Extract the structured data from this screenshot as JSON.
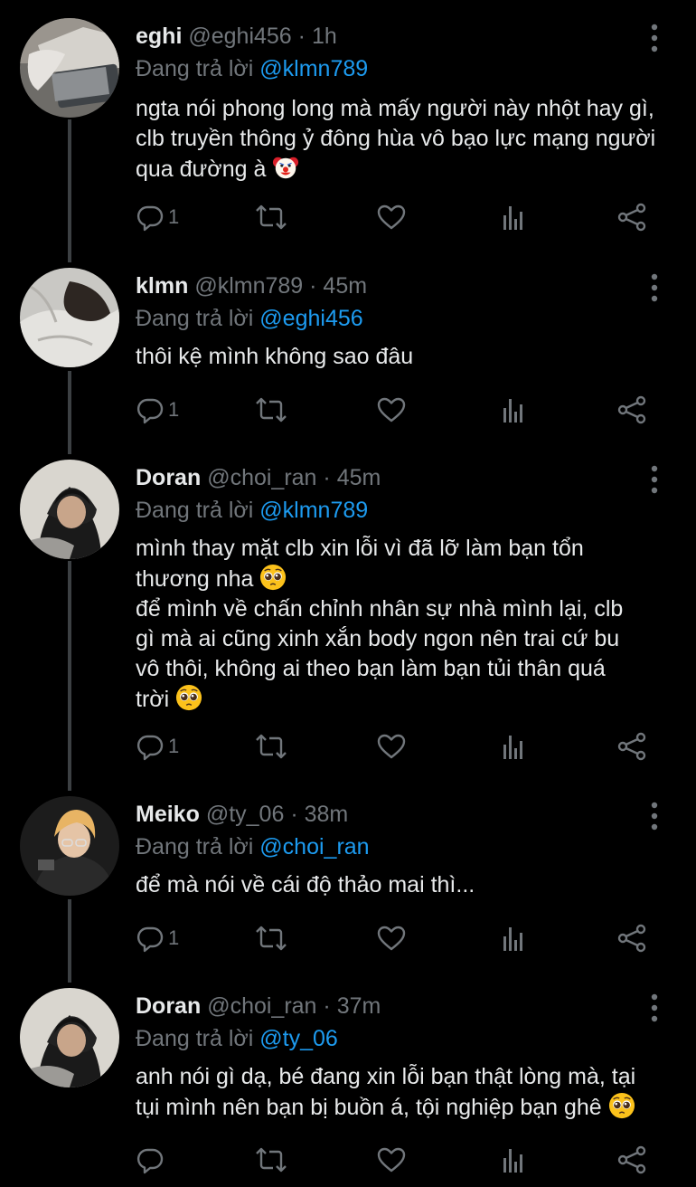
{
  "reply_prefix": "Đang trả lời",
  "tweets": [
    {
      "name": "eghi",
      "handle": "@eghi456",
      "time": "1h",
      "reply_to": "@klmn789",
      "text": "ngta nói phong long mà mấy người này nhột hay gì, clb truyền thông ỷ đông hùa vô bạo lực mạng người qua đường à",
      "emoji": "clown-face",
      "reply_count": "1"
    },
    {
      "name": "klmn",
      "handle": "@klmn789",
      "time": "45m",
      "reply_to": "@eghi456",
      "text": "thôi kệ mình không sao đâu",
      "reply_count": "1"
    },
    {
      "name": "Doran",
      "handle": "@choi_ran",
      "time": "45m",
      "reply_to": "@klmn789",
      "text_lines": [
        "mình thay mặt clb xin lỗi vì đã lỡ làm bạn tổn",
        "thương nha",
        "để mình về chấn chỉnh nhân sự nhà mình lại, clb",
        "gì mà ai cũng xinh xắn body ngon nên trai cứ bu",
        "vô thôi, không ai theo bạn làm bạn tủi thân quá",
        "trời"
      ],
      "emoji": "pleading-face",
      "reply_count": "1"
    },
    {
      "name": "Meiko",
      "handle": "@ty_06",
      "time": "38m",
      "reply_to": "@choi_ran",
      "text": "để mà nói về cái độ thảo mai thì...",
      "reply_count": "1"
    },
    {
      "name": "Doran",
      "handle": "@choi_ran",
      "time": "37m",
      "reply_to": "@ty_06",
      "text_lines": [
        "anh nói gì dạ, bé đang xin lỗi bạn thật lòng mà, tại",
        "tụi mình nên bạn bị buồn á, tội nghiệp bạn ghê"
      ],
      "emoji": "pleading-face",
      "reply_count": ""
    }
  ],
  "colors": {
    "background": "#000000",
    "text": "#e7e9ea",
    "muted": "#71767b",
    "mention": "#1d9bf0",
    "thread_line": "#3c4043"
  },
  "icons": [
    "reply-icon",
    "retweet-icon",
    "like-icon",
    "analytics-icon",
    "share-icon",
    "more-icon",
    "clown-face",
    "pleading-face"
  ]
}
